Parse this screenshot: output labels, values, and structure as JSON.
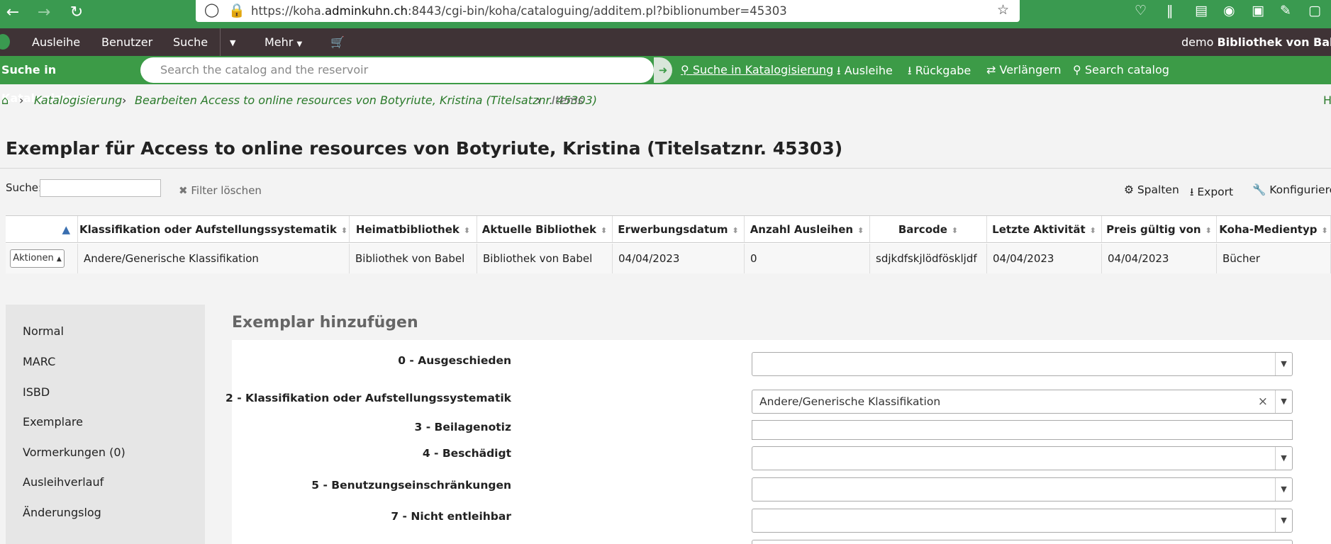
{
  "browser": {
    "url_prefix": "https://koha.",
    "url_domain": "adminkuhn.ch",
    "url_suffix": ":8443/cgi-bin/koha/cataloguing/additem.pl?biblionumber=45303"
  },
  "topnav": {
    "items": [
      "Ausleihe",
      "Benutzer",
      "Suche",
      "Mehr"
    ],
    "library_prefix": "demo",
    "library_name": "Bibliothek von Babel"
  },
  "searchbar": {
    "label": "Suche in Katalogisierung",
    "placeholder": "Search the catalog and the reservoir",
    "links": [
      "Suche in Katalogisierung",
      "Ausleihe",
      "Rückgabe",
      "Verlängern",
      "Search catalog"
    ]
  },
  "breadcrumb": {
    "items": [
      "Katalogisierung",
      "Bearbeiten Access to online resources von Botyriute, Kristina (Titelsatznr. 45303)"
    ],
    "current": "Items",
    "trailing": "H"
  },
  "page_title": "Exemplar für Access to online resources von Botyriute, Kristina (Titelsatznr. 45303)",
  "table_tools": {
    "search_label": "Suche:",
    "clear_filter": "Filter löschen",
    "columns": "Spalten",
    "export": "Export",
    "configure": "Konfigurieren"
  },
  "items_table": {
    "headers": [
      "Klassifikation oder Aufstellungssystematik",
      "Heimatbibliothek",
      "Aktuelle Bibliothek",
      "Erwerbungsdatum",
      "Anzahl Ausleihen",
      "Barcode",
      "Letzte Aktivität",
      "Preis gültig von",
      "Koha-Medientyp"
    ],
    "actions_label": "Aktionen",
    "row": [
      "Andere/Generische Klassifikation",
      "Bibliothek von Babel",
      "Bibliothek von Babel",
      "04/04/2023",
      "0",
      "sdjkdfskjlödföskljdf",
      "04/04/2023",
      "04/04/2023",
      "Bücher"
    ]
  },
  "sidenav": {
    "items": [
      "Normal",
      "MARC",
      "ISBD",
      "Exemplare",
      "Vormerkungen (0)",
      "Ausleihverlauf",
      "Änderungslog"
    ]
  },
  "form": {
    "title": "Exemplar hinzufügen",
    "fields": [
      {
        "label": "0 - Ausgeschieden",
        "value": ""
      },
      {
        "label": "2 - Klassifikation oder Aufstellungssystematik",
        "value": "Andere/Generische Klassifikation"
      },
      {
        "label": "3 - Beilagenotiz",
        "value": ""
      },
      {
        "label": "4 - Beschädigt",
        "value": ""
      },
      {
        "label": "5 - Benutzungseinschränkungen",
        "value": ""
      },
      {
        "label": "7 - Nicht entleihbar",
        "value": ""
      }
    ]
  }
}
